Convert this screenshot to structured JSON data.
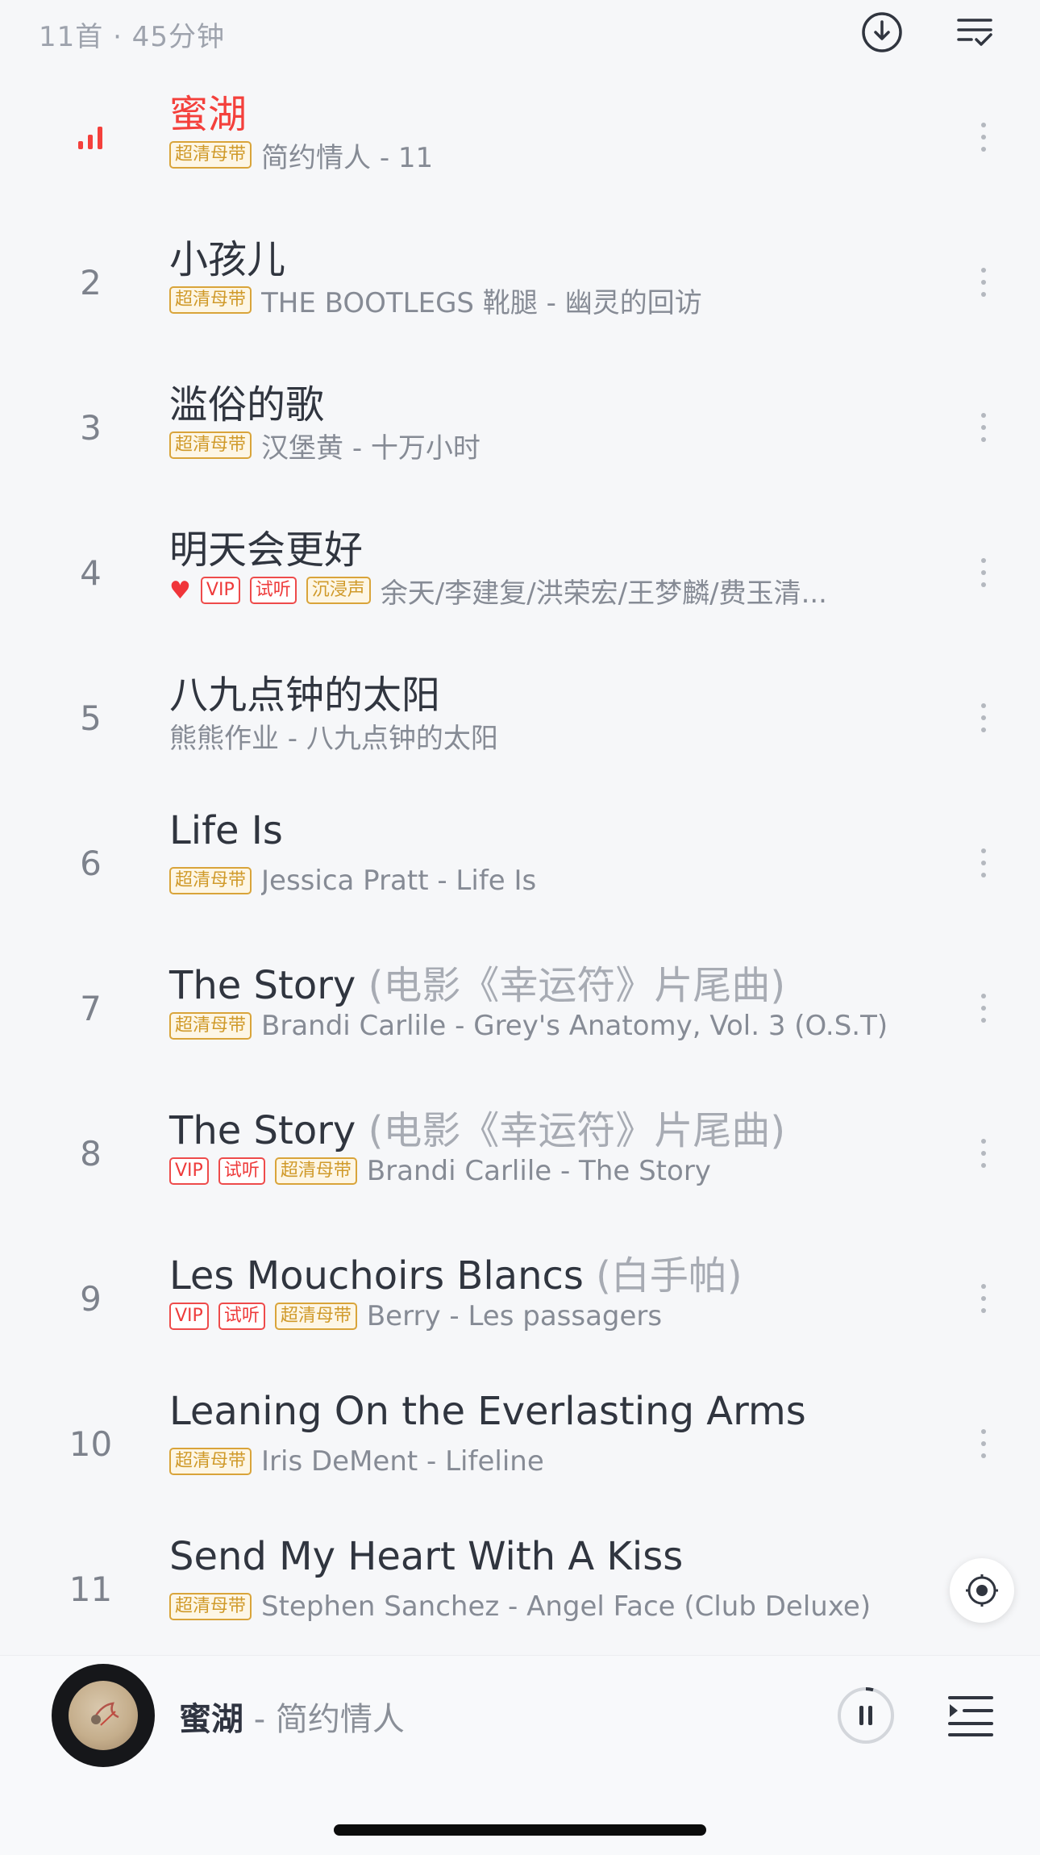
{
  "header": {
    "summary": "11首 · 45分钟",
    "download_icon": "download-icon",
    "select_icon": "multi-select-icon"
  },
  "colors": {
    "accent": "#f4403c",
    "gold_tag": "#d9a43a",
    "red_tag": "#ee4b4b"
  },
  "tracks": [
    {
      "index": "",
      "playing": true,
      "title": "蜜湖",
      "alias": "",
      "tags": [
        "超清母带"
      ],
      "subtitle": "简约情人 - 11"
    },
    {
      "index": "2",
      "title": "小孩儿",
      "alias": "",
      "tags": [
        "超清母带"
      ],
      "subtitle": "THE BOOTLEGS 靴腿 - 幽灵的回访"
    },
    {
      "index": "3",
      "title": "滥俗的歌",
      "alias": "",
      "tags": [
        "超清母带"
      ],
      "subtitle": "汉堡黄 - 十万小时"
    },
    {
      "index": "4",
      "title": "明天会更好",
      "alias": "",
      "liked": true,
      "tags": [
        "VIP",
        "试听",
        "沉浸声"
      ],
      "subtitle": "余天/李建复/洪荣宏/王梦麟/费玉清..."
    },
    {
      "index": "5",
      "title": "八九点钟的太阳",
      "alias": "",
      "tags": [],
      "subtitle": "熊熊作业 - 八九点钟的太阳"
    },
    {
      "index": "6",
      "title": "Life Is",
      "alias": "",
      "tags": [
        "超清母带"
      ],
      "subtitle": "Jessica Pratt - Life Is"
    },
    {
      "index": "7",
      "title": "The Story ",
      "alias": "(电影《幸运符》片尾曲)",
      "tags": [
        "超清母带"
      ],
      "subtitle": "Brandi Carlile - Grey's Anatomy, Vol. 3 (O.S.T)"
    },
    {
      "index": "8",
      "title": "The Story ",
      "alias": "(电影《幸运符》片尾曲)",
      "tags": [
        "VIP",
        "试听",
        "超清母带"
      ],
      "subtitle": "Brandi Carlile - The Story"
    },
    {
      "index": "9",
      "title": "Les Mouchoirs Blancs ",
      "alias": "(白手帕)",
      "tags": [
        "VIP",
        "试听",
        "超清母带"
      ],
      "subtitle": "Berry - Les passagers"
    },
    {
      "index": "10",
      "title": "Leaning On the Everlasting Arms",
      "alias": "",
      "tags": [
        "超清母带"
      ],
      "subtitle": "Iris DeMent - Lifeline"
    },
    {
      "index": "11",
      "title": "Send My Heart With A Kiss",
      "alias": "",
      "tags": [
        "超清母带"
      ],
      "subtitle": "Stephen Sanchez - Angel Face (Club Deluxe)"
    }
  ],
  "now_playing": {
    "song": "蜜湖",
    "separator": " - ",
    "artist": "简约情人",
    "state": "playing",
    "pause_icon": "pause-icon",
    "playlist_icon": "playlist-icon"
  }
}
